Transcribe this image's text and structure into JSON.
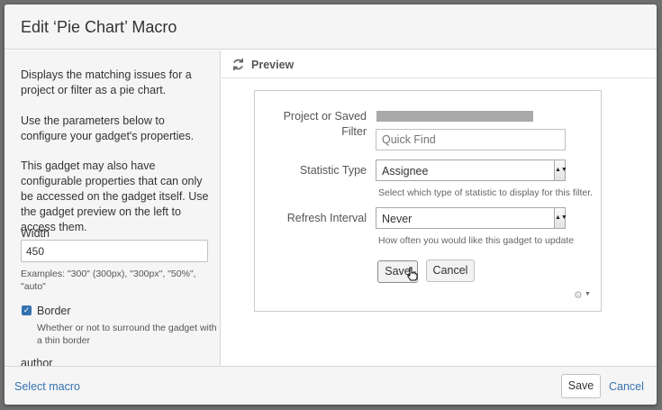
{
  "dialog": {
    "title": "Edit ‘Pie Chart’ Macro"
  },
  "sidebar": {
    "description": "Displays the matching issues for a project or filter as a pie chart.",
    "params_hint": "Use the parameters below to configure your gadget's properties.",
    "gadget_note": "This gadget may also have configurable properties that can only be accessed on the gadget itself. Use the gadget preview on the left to access them.",
    "width_label": "Width",
    "width_value": "450",
    "width_examples": "Examples: \"300\" (300px), \"300px\", \"50%\", \"auto\"",
    "border_label": "Border",
    "border_checked": true,
    "border_hint": "Whether or not to surround the gadget with a thin border",
    "author_label": "author"
  },
  "preview": {
    "title": "Preview",
    "form": {
      "project_label_line1": "Project or Saved",
      "project_label_line2": "Filter",
      "quick_find_placeholder": "Quick Find",
      "statistic_label": "Statistic Type",
      "statistic_value": "Assignee",
      "statistic_desc": "Select which type of statistic to display for this filter.",
      "refresh_label": "Refresh Interval",
      "refresh_value": "Never",
      "refresh_desc": "How often you would like this gadget to update",
      "save_label": "Save",
      "cancel_label": "Cancel"
    }
  },
  "footer": {
    "select_macro": "Select macro",
    "save": "Save",
    "cancel": "Cancel"
  },
  "colors": {
    "link": "#3572b0",
    "backdrop": "#6f6f6f",
    "panel": "#f5f5f5"
  }
}
